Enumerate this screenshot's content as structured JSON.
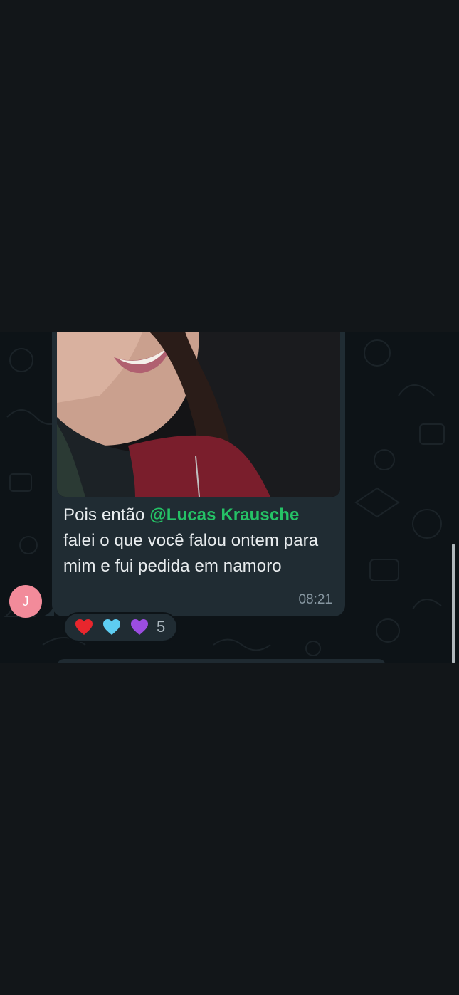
{
  "message": {
    "text_before": "Pois então ",
    "mention": "@Lucas Krausche",
    "text_after": " falei o que você falou ontem para mim e fui pedida em namoro",
    "time": "08:21"
  },
  "sender": {
    "avatar_initial": "J",
    "avatar_color": "#f28b9a"
  },
  "reactions": {
    "items": [
      {
        "icon": "red-heart-icon",
        "color": "#e8262d"
      },
      {
        "icon": "light-blue-heart-icon",
        "color": "#5ecdf2"
      },
      {
        "icon": "purple-heart-icon",
        "color": "#9b4de0"
      }
    ],
    "count": "5"
  },
  "colors": {
    "background": "#121619",
    "chat_background": "#0d1317",
    "bubble": "#202c33",
    "mention": "#25c266",
    "time": "#8696a0"
  }
}
